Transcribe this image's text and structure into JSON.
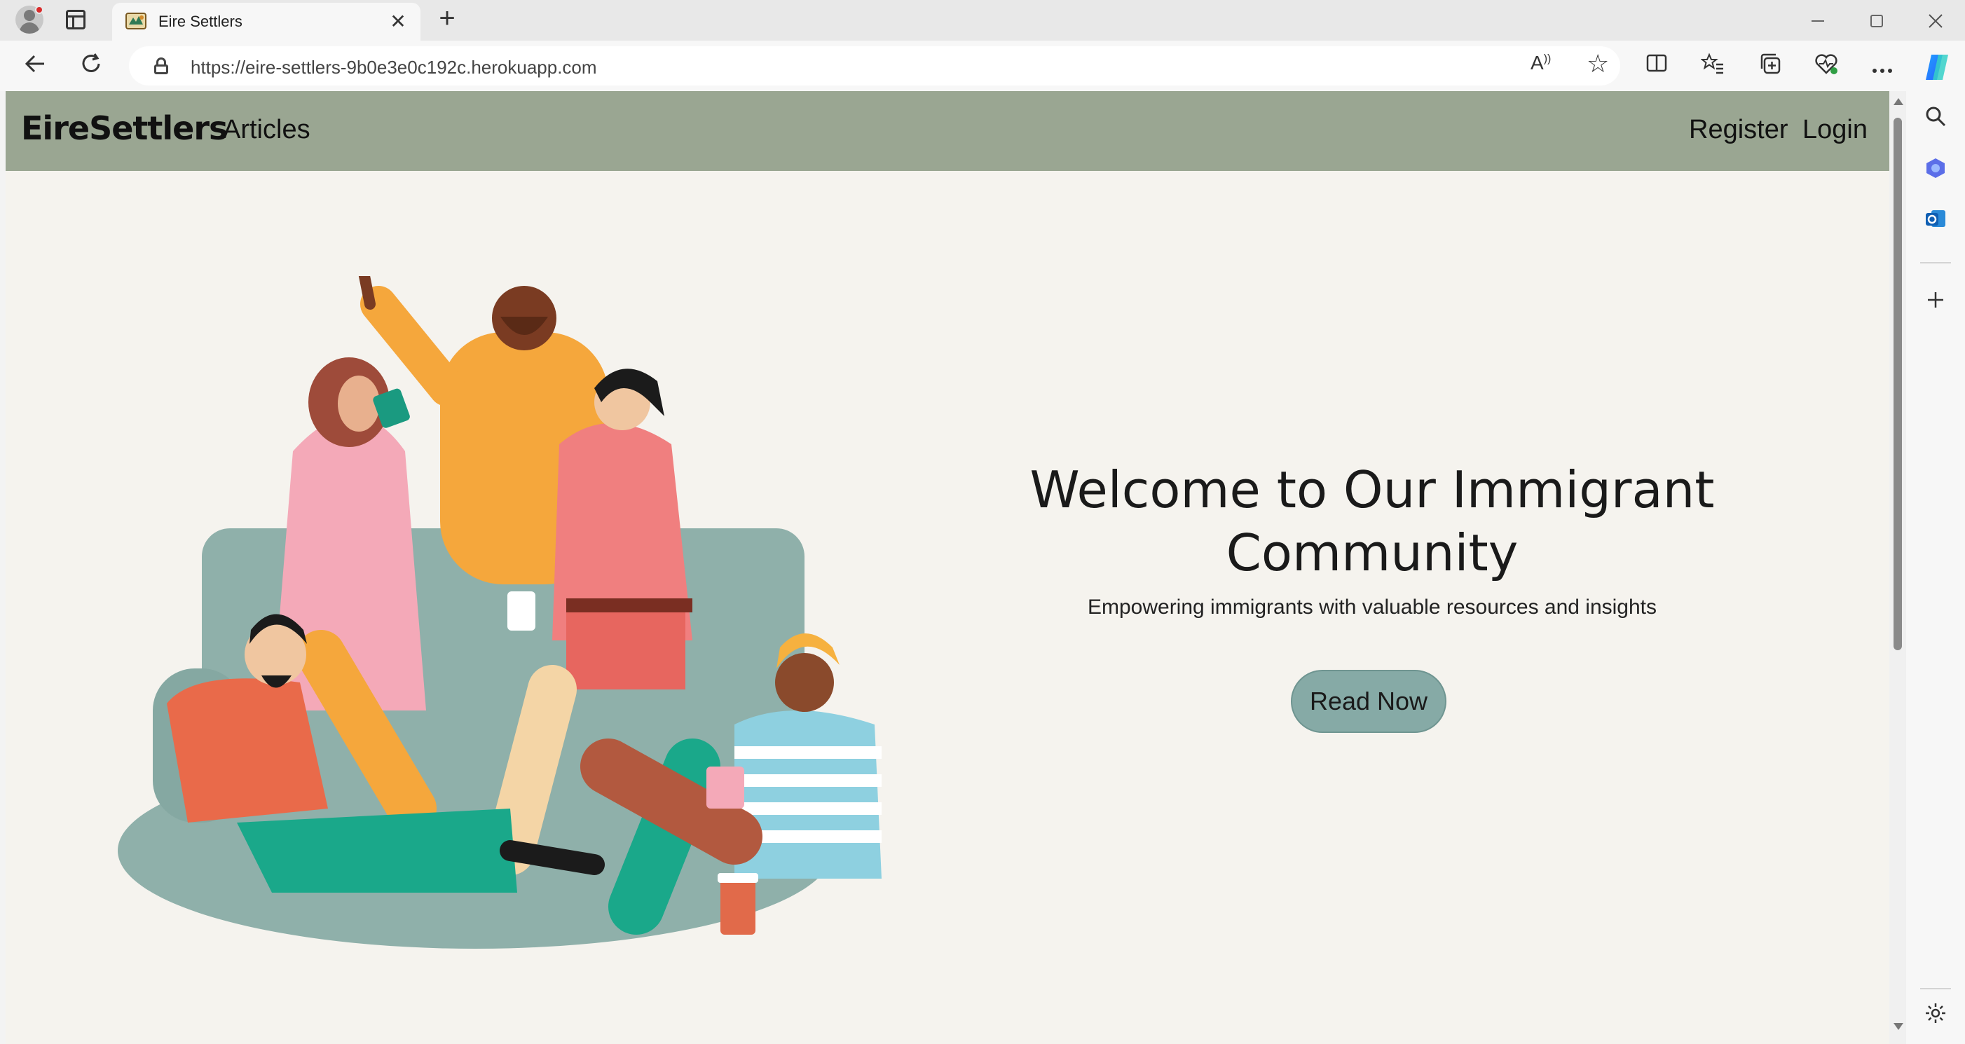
{
  "browser": {
    "tab": {
      "title": "Eire Settlers",
      "close_glyph": "✕"
    },
    "new_tab_glyph": "+",
    "address": {
      "url": "https://eire-settlers-9b0e3e0c192c.herokuapp.com"
    },
    "toolbar_icons": [
      "back-icon",
      "refresh-icon",
      "lock-icon",
      "read-aloud-icon",
      "favorite-star-icon",
      "split-screen-icon",
      "favorites-icon",
      "collections-icon",
      "browser-essentials-icon",
      "more-icon",
      "copilot-icon"
    ],
    "sidebar_icons": [
      "search-icon",
      "copilot-sidebar-icon",
      "outlook-icon",
      "add-icon",
      "settings-icon"
    ]
  },
  "page": {
    "navbar": {
      "brand": "EireSettlers",
      "links": [
        {
          "label": "Articles"
        },
        {
          "label": "Register"
        },
        {
          "label": "Login"
        }
      ]
    },
    "hero": {
      "title": "Welcome to Our Immigrant Community",
      "subtitle": "Empowering immigrants with valuable resources and insights",
      "cta_label": "Read Now"
    }
  },
  "colors": {
    "navbar_bg": "#9aa692",
    "page_bg": "#f5f3ee",
    "cta_bg": "#86aaa6",
    "sofa": "#8fb0aa"
  }
}
